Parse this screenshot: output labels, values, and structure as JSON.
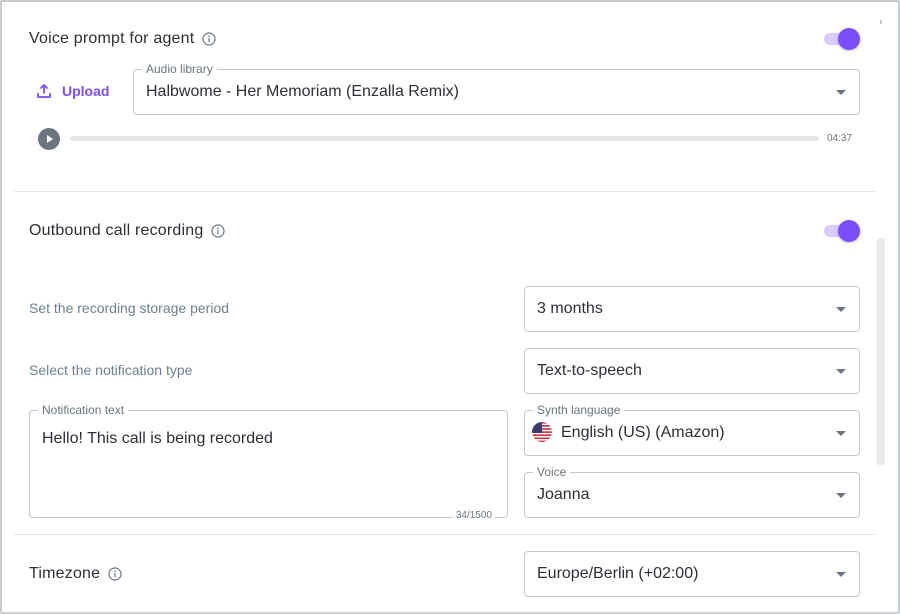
{
  "voice_prompt": {
    "title": "Voice prompt for agent",
    "toggle_on": true,
    "upload_label": "Upload",
    "audio_library": {
      "label": "Audio library",
      "value": "Halbwome - Her Memoriam (Enzalla Remix)"
    },
    "player": {
      "duration": "04:37",
      "progress": 0
    }
  },
  "outbound_recording": {
    "title": "Outbound call recording",
    "toggle_on": true,
    "storage_period": {
      "label": "Set the recording storage period",
      "value": "3 months"
    },
    "notification_type": {
      "label": "Select the notification type",
      "value": "Text-to-speech"
    },
    "notification_text": {
      "label": "Notification text",
      "value": "Hello! This call is being recorded",
      "counter": "34/1500"
    },
    "synth_language": {
      "label": "Synth language",
      "value": "English (US) (Amazon)",
      "flag_icon": "us-flag-icon"
    },
    "voice": {
      "label": "Voice",
      "value": "Joanna"
    }
  },
  "timezone": {
    "title": "Timezone",
    "value": "Europe/Berlin (+02:00)"
  },
  "colors": {
    "accent": "#7c4dff",
    "toggle_track": "#d9cbfb",
    "muted_label": "#6b8191"
  }
}
